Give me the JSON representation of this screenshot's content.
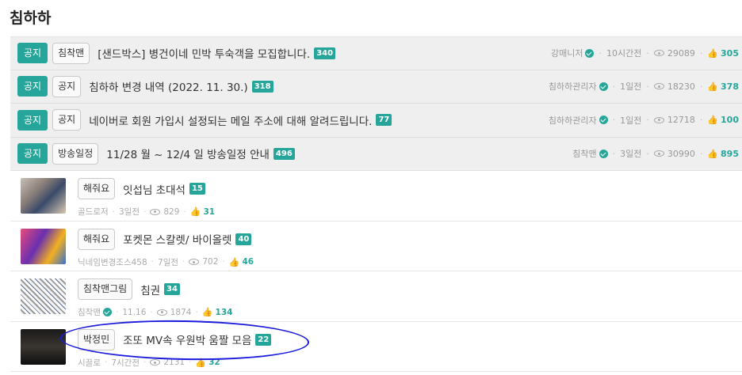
{
  "board": {
    "title": "침하하"
  },
  "notices": [
    {
      "badge": "공지",
      "category": "침착맨",
      "title": "[샌드박스] 병건이네 민박 투숙객을 모집합니다.",
      "comments": "340",
      "author": "강매니저",
      "time": "10시간전",
      "views": "29089",
      "likes": "305"
    },
    {
      "badge": "공지",
      "category": "공지",
      "title": "침하하 변경 내역 (2022. 11. 30.)",
      "comments": "318",
      "author": "침하하관리자",
      "time": "1일전",
      "views": "18230",
      "likes": "378"
    },
    {
      "badge": "공지",
      "category": "공지",
      "title": "네이버로 회원 가입시 설정되는 메일 주소에 대해 알려드립니다.",
      "comments": "77",
      "author": "침하하관리자",
      "time": "1일전",
      "views": "12718",
      "likes": "100"
    },
    {
      "badge": "공지",
      "category": "방송일정",
      "title": "11/28 월 ~ 12/4 일 방송일정 안내",
      "comments": "496",
      "author": "침착맨",
      "time": "3일전",
      "views": "30990",
      "likes": "895"
    }
  ],
  "posts": [
    {
      "category": "해줘요",
      "title": "잇섭님 초대석",
      "comments": "15",
      "author": "골드로저",
      "time": "3일전",
      "views": "829",
      "likes": "31",
      "thumb_icon": "photo-thumbnail"
    },
    {
      "category": "해줘요",
      "title": "포켓몬 스칼렛/ 바이올렛",
      "comments": "40",
      "author": "닉네임변경조스458",
      "time": "7일전",
      "views": "702",
      "likes": "46",
      "thumb_icon": "photo-thumbnail"
    },
    {
      "category": "침착맨그림",
      "title": "침권",
      "comments": "34",
      "author": "침착맨",
      "time": "11.16",
      "views": "1874",
      "likes": "134",
      "thumb_icon": "photo-thumbnail"
    },
    {
      "category": "박정민",
      "title": "조또 MV속 우원박 움짤 모음",
      "comments": "22",
      "author": "시끌로",
      "time": "7시간전",
      "views": "2131",
      "likes": "32",
      "thumb_icon": "photo-thumbnail"
    }
  ],
  "colors": {
    "accent": "#26a69a",
    "highlight_ring": "#1a1adc"
  }
}
